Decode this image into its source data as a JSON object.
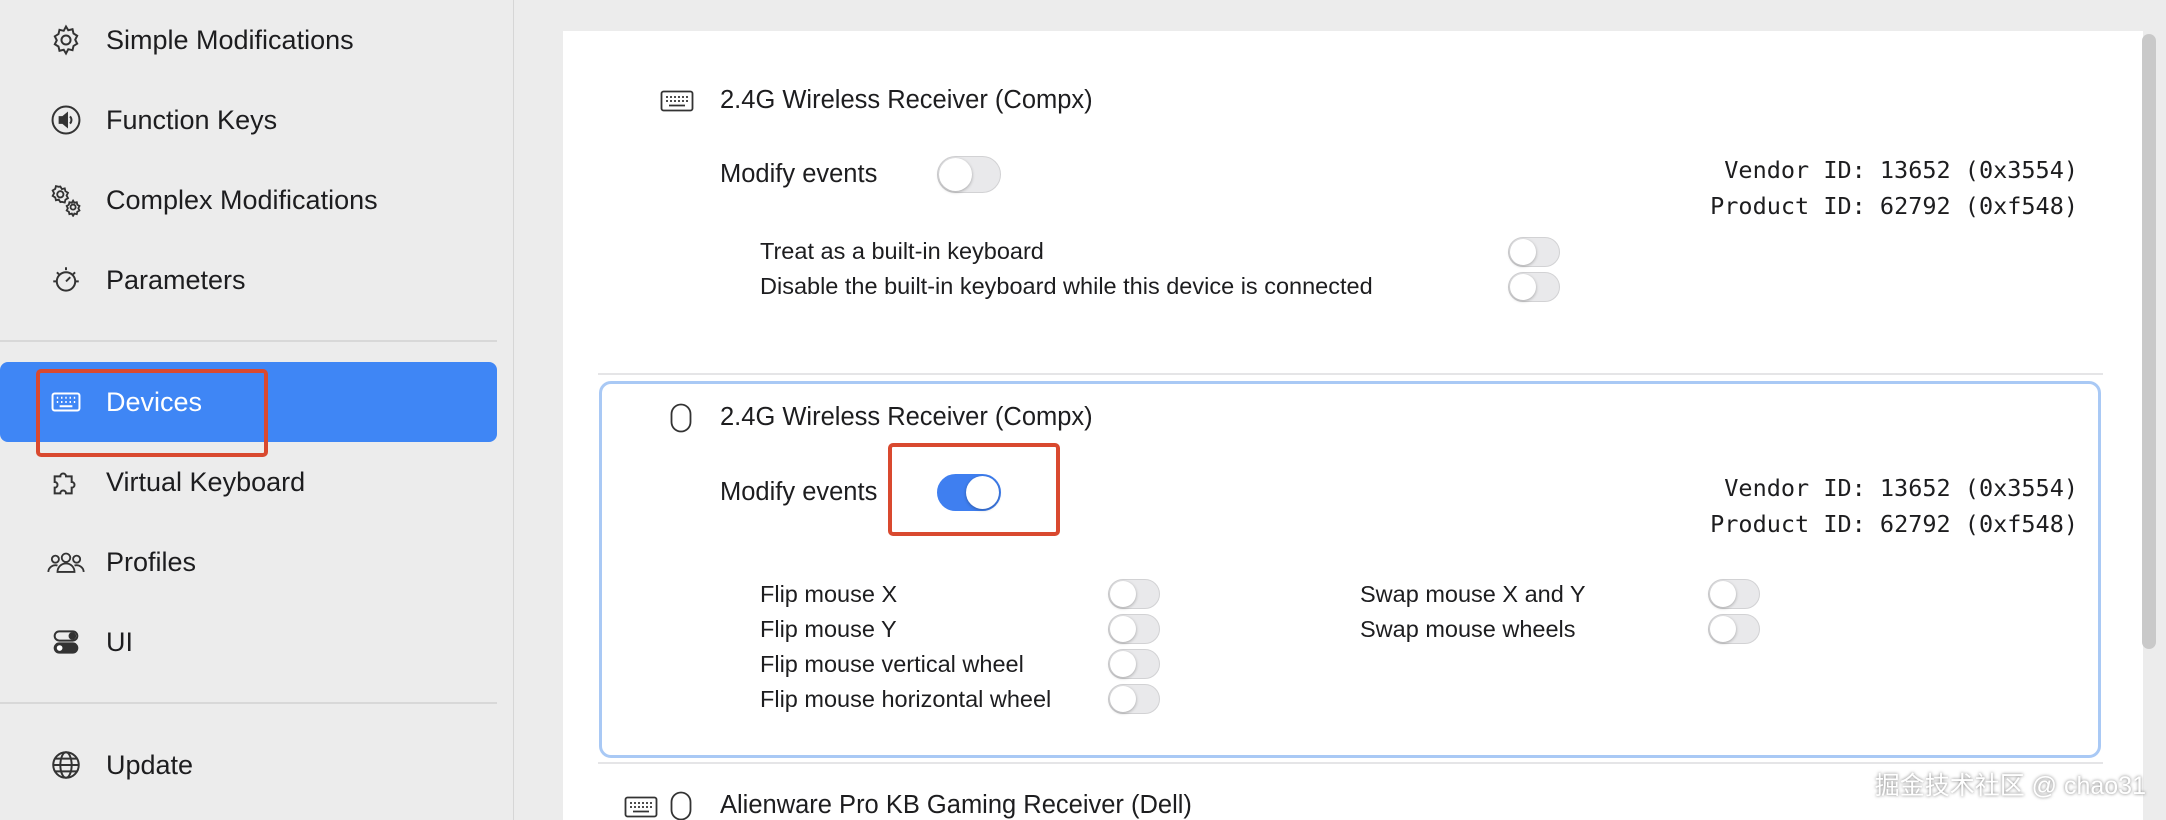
{
  "sidebar": {
    "items": [
      {
        "label": "Simple Modifications",
        "icon": "gear-icon"
      },
      {
        "label": "Function Keys",
        "icon": "speaker-icon"
      },
      {
        "label": "Complex Modifications",
        "icon": "gears-icon"
      },
      {
        "label": "Parameters",
        "icon": "gauge-icon"
      },
      {
        "label": "Devices",
        "icon": "keyboard-icon",
        "active": true
      },
      {
        "label": "Virtual Keyboard",
        "icon": "puzzle-icon"
      },
      {
        "label": "Profiles",
        "icon": "people-icon"
      },
      {
        "label": "UI",
        "icon": "toggles-icon"
      },
      {
        "label": "Update",
        "icon": "globe-icon"
      }
    ]
  },
  "devices": [
    {
      "name": "2.4G Wireless Receiver (Compx)",
      "icon": "keyboard-icon",
      "modify_events_label": "Modify events",
      "modify_events": false,
      "vendor_id": "Vendor ID: 13652 (0x3554)",
      "product_id": "Product ID: 62792 (0xf548)",
      "options": [
        {
          "label": "Treat as a built-in keyboard",
          "on": false
        },
        {
          "label": "Disable the built-in keyboard while this device is connected",
          "on": false
        }
      ]
    },
    {
      "name": "2.4G Wireless Receiver (Compx)",
      "icon": "mouse-icon",
      "modify_events_label": "Modify events",
      "modify_events": true,
      "vendor_id": "Vendor ID: 13652 (0x3554)",
      "product_id": "Product ID: 62792 (0xf548)",
      "options_left": [
        {
          "label": "Flip mouse X",
          "on": false
        },
        {
          "label": "Flip mouse Y",
          "on": false
        },
        {
          "label": "Flip mouse vertical wheel",
          "on": false
        },
        {
          "label": "Flip mouse horizontal wheel",
          "on": false
        }
      ],
      "options_right": [
        {
          "label": "Swap mouse X and Y",
          "on": false
        },
        {
          "label": "Swap mouse wheels",
          "on": false
        }
      ]
    },
    {
      "name": "Alienware Pro KB Gaming Receiver (Dell)",
      "icons": [
        "keyboard-icon",
        "mouse-icon"
      ]
    }
  ],
  "watermark": "掘金技术社区 @ chao31",
  "colors": {
    "accent": "#3f86f5",
    "annotation": "#d9492f",
    "toggle_on": "#3f7ff0",
    "selection_border": "#a9c9f5"
  }
}
